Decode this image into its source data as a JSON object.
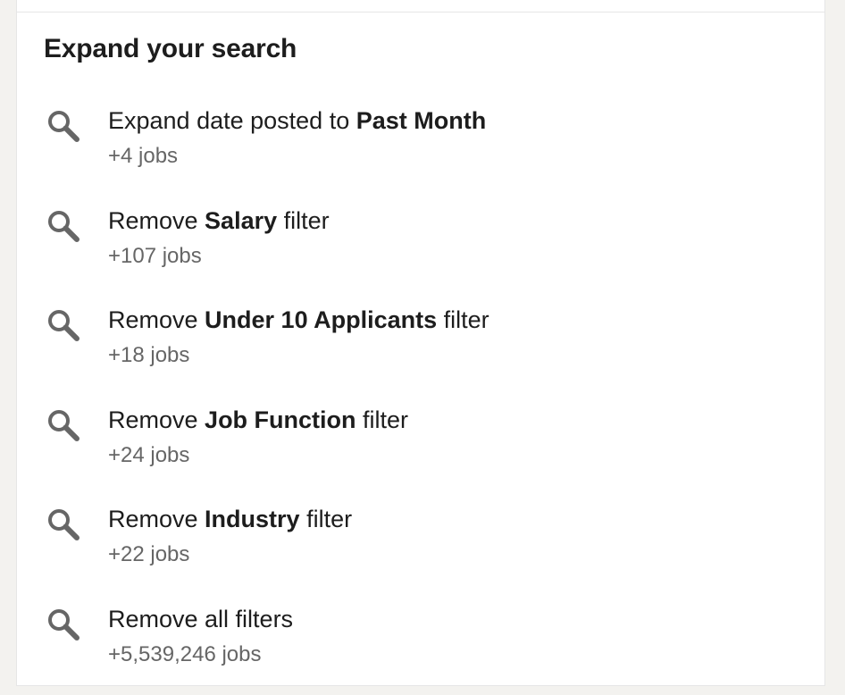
{
  "panel": {
    "heading": "Expand your search"
  },
  "suggestions": [
    {
      "prefix": "Expand date posted to ",
      "emphasis": "Past Month",
      "suffix": "",
      "count": "+4 jobs",
      "icon": "search-icon"
    },
    {
      "prefix": "Remove ",
      "emphasis": "Salary",
      "suffix": " filter",
      "count": "+107 jobs",
      "icon": "search-icon"
    },
    {
      "prefix": "Remove ",
      "emphasis": "Under 10 Applicants",
      "suffix": " filter",
      "count": "+18 jobs",
      "icon": "search-icon"
    },
    {
      "prefix": "Remove ",
      "emphasis": "Job Function",
      "suffix": " filter",
      "count": "+24 jobs",
      "icon": "search-icon"
    },
    {
      "prefix": "Remove ",
      "emphasis": "Industry",
      "suffix": " filter",
      "count": "+22 jobs",
      "icon": "search-icon"
    },
    {
      "prefix": "Remove all filters",
      "emphasis": "",
      "suffix": "",
      "count": "+5,539,246 jobs",
      "icon": "search-icon"
    }
  ],
  "colors": {
    "page_background": "#f3f2ef",
    "card_background": "#ffffff",
    "text_primary": "#1d1d1d",
    "text_secondary": "#666666",
    "icon": "#666666"
  }
}
